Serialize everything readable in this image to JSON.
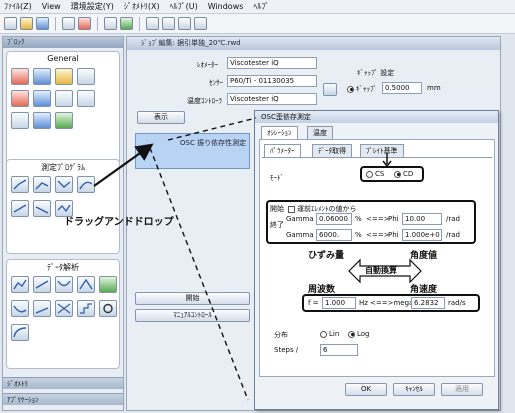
{
  "menu": [
    "ﾌｧｲﾙ(Z)",
    "View",
    "環境設定(Y)",
    "ｼﾞｵﾒﾄﾘ(X)",
    "ﾍﾙﾌﾟ(U)",
    "Windows",
    "ﾍﾙﾌﾟ"
  ],
  "sidebar": {
    "header": "ﾌﾞﾛｯｸ",
    "group_general": "General",
    "group_measure": "測定ﾌﾟﾛｸﾞﾗﾑ",
    "group_analysis": "ﾃﾞｰﾀ解析",
    "footer1": "ｼﾞｵﾒﾄﾘ",
    "footer2": "ｱﾌﾟﾘｹｰｼｮﾝ"
  },
  "main": {
    "title": "ｼﾞｮﾌﾞ編集: 据引単独_20℃.rwd",
    "rheometer_label": "ﾚｵﾒｰﾀｰ",
    "rheometer_value": "Viscotester iQ",
    "sensor_label": "ｾﾝｻｰ",
    "sensor_value": "P60/Ti - 01130035",
    "temp_label": "温度ｺﾝﾄﾛｰﾗ",
    "temp_value": "Viscotester iQ",
    "gap_label": "ｷﾞｬｯﾌﾟ 設定",
    "gap_value": "0.5000",
    "gap_unit": "mm",
    "gap_radio": "ｷﾞｬｯﾌﾟ",
    "display_button": "表示",
    "job_item": "OSC 振り依存性測定",
    "start_button": "開始",
    "manual_button": "ﾏﾆｭｱﾙｺﾝﾄﾛｰﾙ"
  },
  "dialog": {
    "title": "OSC歪依存測定",
    "tabs": [
      "ｵｼﾚｰｼｮﾝ",
      "温度"
    ],
    "subtabs": [
      "ﾊﾟﾗﾒｰﾀｰ",
      "ﾃﾞｰﾀ取得",
      "ﾌﾟﾚｲﾄ基準"
    ],
    "mode_label": "ﾓｰﾄﾞ",
    "mode_cs": "CS",
    "mode_cd": "CD",
    "start_label": "開始",
    "prev_check": "運前ｴﾚﾒﾝﾄの値から",
    "end_label": "終了",
    "gamma_label": "Gamma",
    "gamma_start": "0.06000",
    "gamma_end": "6000.",
    "pct": "%",
    "arrow": "<==>",
    "phi_label": "Phi",
    "phi_start": "10.00",
    "phi_end": "1.000e+0",
    "phi_unit": "/rad",
    "strain_heading": "ひずみ量",
    "angle_heading": "角度値",
    "auto_convert": "自動換算",
    "freq_heading": "周波数",
    "angvel_heading": "角速度",
    "f_label": "f =",
    "f_value": "1.000",
    "f_unit": "Hz",
    "omega_label": "<==>mega",
    "omega_value": "6.2832",
    "omega_unit": "rad/s",
    "dist_label": "分布",
    "dist_lin": "Lin",
    "dist_log": "Log",
    "steps_label": "Steps /",
    "steps_value": "6",
    "ok": "OK",
    "cancel": "ｷｬﾝｾﾙ",
    "apply": "適用"
  },
  "annotation": "ドラッグアンドドロップ"
}
